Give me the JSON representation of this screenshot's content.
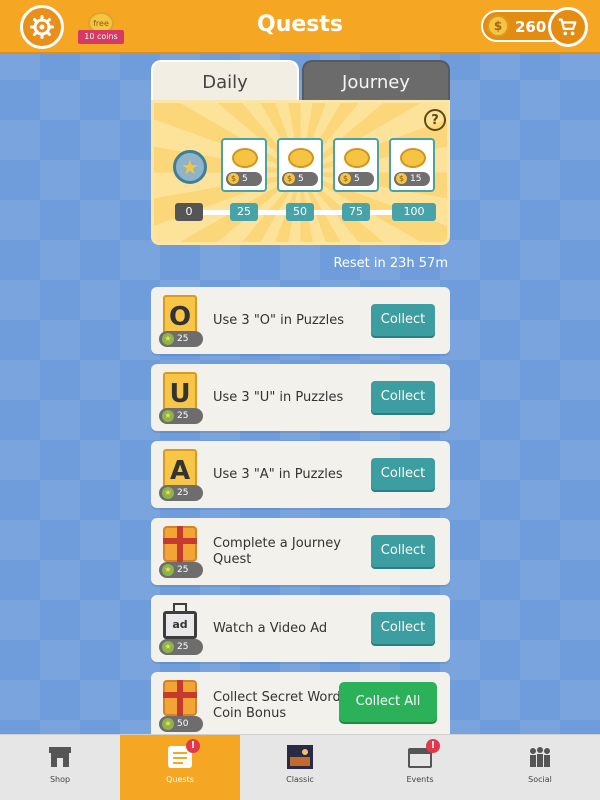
{
  "header": {
    "title": "Quests",
    "free_badge_top": "free",
    "free_badge_bottom": "10 coins",
    "coins": "260",
    "icons": {
      "settings": "gear-icon",
      "cart": "cart-icon",
      "coin": "coin-icon"
    }
  },
  "tabs": [
    {
      "label": "Daily",
      "active": true
    },
    {
      "label": "Journey",
      "active": false
    }
  ],
  "progress_panel": {
    "help": "?",
    "rewards": [
      "5",
      "5",
      "5",
      "15"
    ],
    "milestones": [
      "0",
      "25",
      "50",
      "75",
      "100"
    ]
  },
  "reset_text": "Reset in 23h 57m",
  "quests": [
    {
      "icon": "letter-o-tile",
      "letter": "O",
      "points": "25",
      "label": "Use 3 \"O\" in Puzzles",
      "button": "Collect"
    },
    {
      "icon": "letter-u-tile",
      "letter": "U",
      "points": "25",
      "label": "Use 3 \"U\" in Puzzles",
      "button": "Collect"
    },
    {
      "icon": "letter-a-tile",
      "letter": "A",
      "points": "25",
      "label": "Use 3 \"A\" in Puzzles",
      "button": "Collect"
    },
    {
      "icon": "gift-icon",
      "points": "25",
      "label": "Complete a Journey Quest",
      "button": "Collect"
    },
    {
      "icon": "tv-ad-icon",
      "tv_text": "ad",
      "points": "25",
      "label": "Watch a Video Ad",
      "button": "Collect"
    },
    {
      "icon": "gift-icon",
      "points": "50",
      "label": "Collect Secret Words Coin Bonus",
      "button": "Collect All"
    }
  ],
  "bottom_nav": [
    {
      "label": "Shop",
      "icon": "shop-icon",
      "active": false
    },
    {
      "label": "Quests",
      "icon": "quests-icon",
      "active": true,
      "notification": "!"
    },
    {
      "label": "Classic",
      "icon": "classic-icon",
      "active": false
    },
    {
      "label": "Events",
      "icon": "calendar-icon",
      "active": false,
      "notification": "!"
    },
    {
      "label": "Social",
      "icon": "social-icon",
      "active": false
    }
  ],
  "colors": {
    "header": "#f5a623",
    "background": "#6f9ddb",
    "collect_button": "#3c9ea0",
    "collect_all_button": "#2bb159",
    "notification": "#e2394a"
  }
}
